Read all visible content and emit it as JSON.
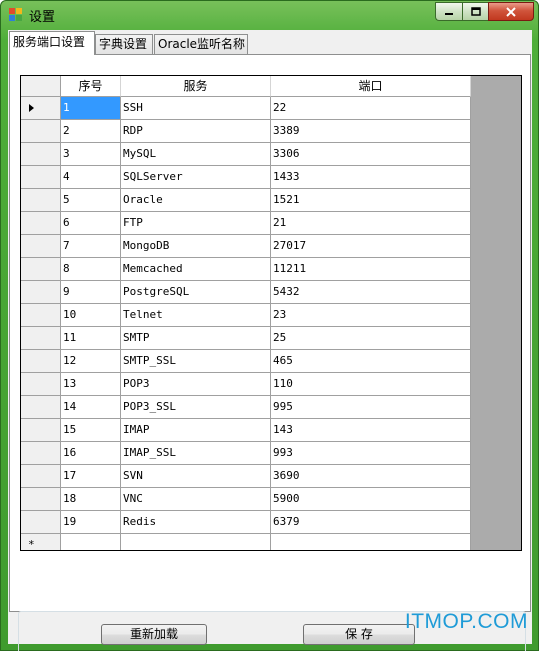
{
  "window": {
    "title": "设置"
  },
  "tabs": [
    {
      "label": "服务端口设置",
      "active": true
    },
    {
      "label": "字典设置",
      "active": false
    },
    {
      "label": "Oracle监听名称",
      "active": false
    }
  ],
  "grid": {
    "columns": [
      "序号",
      "服务",
      "端口"
    ],
    "rows": [
      [
        "1",
        "SSH",
        "22"
      ],
      [
        "2",
        "RDP",
        "3389"
      ],
      [
        "3",
        "MySQL",
        "3306"
      ],
      [
        "4",
        "SQLServer",
        "1433"
      ],
      [
        "5",
        "Oracle",
        "1521"
      ],
      [
        "6",
        "FTP",
        "21"
      ],
      [
        "7",
        "MongoDB",
        "27017"
      ],
      [
        "8",
        "Memcached",
        "11211"
      ],
      [
        "9",
        "PostgreSQL",
        "5432"
      ],
      [
        "10",
        "Telnet",
        "23"
      ],
      [
        "11",
        "SMTP",
        "25"
      ],
      [
        "12",
        "SMTP_SSL",
        "465"
      ],
      [
        "13",
        "POP3",
        "110"
      ],
      [
        "14",
        "POP3_SSL",
        "995"
      ],
      [
        "15",
        "IMAP",
        "143"
      ],
      [
        "16",
        "IMAP_SSL",
        "993"
      ],
      [
        "17",
        "SVN",
        "3690"
      ],
      [
        "18",
        "VNC",
        "5900"
      ],
      [
        "19",
        "Redis",
        "6379"
      ]
    ],
    "new_row_marker": "*"
  },
  "buttons": {
    "reload": "重新加载",
    "save": "保 存"
  },
  "watermark": "ITMOP.COM",
  "colors": {
    "selection": "#3399ff",
    "frame": "#4fae3a",
    "close": "#c1381f"
  },
  "icons": {
    "current_row": "right-triangle",
    "window": "app-squares"
  }
}
